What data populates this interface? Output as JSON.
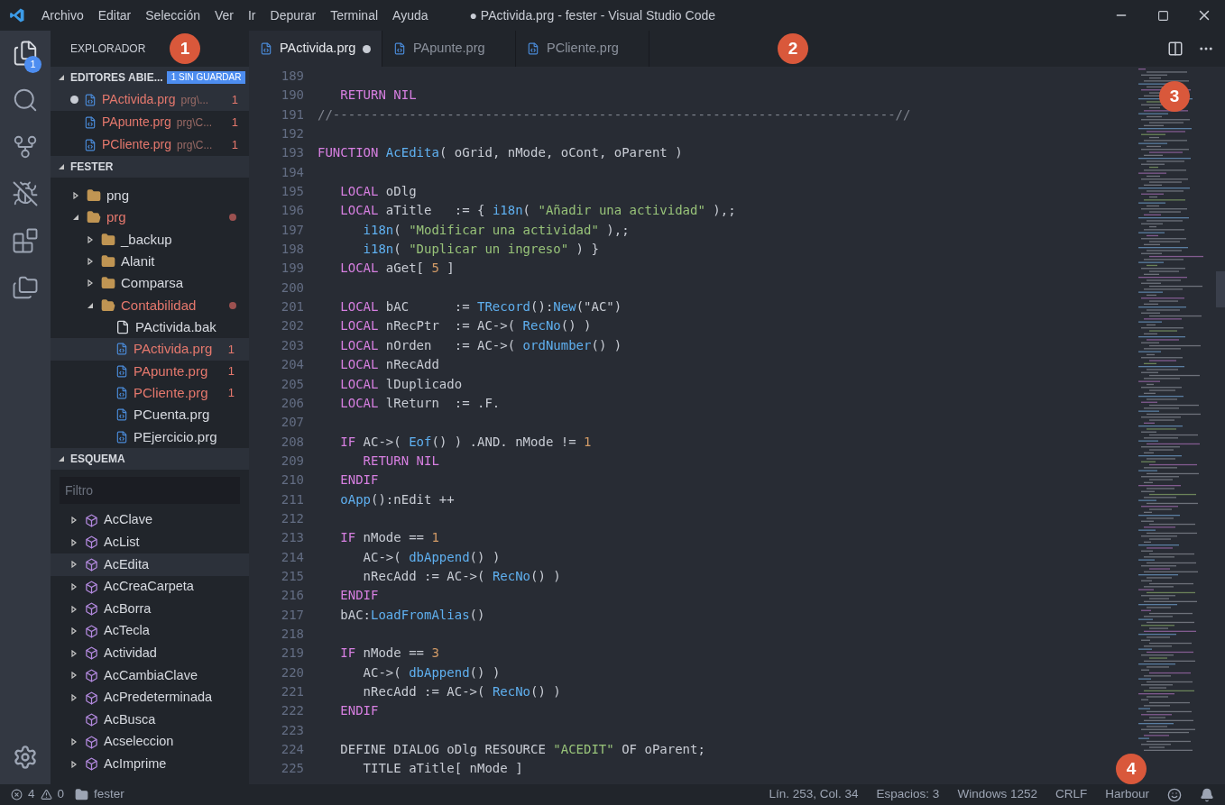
{
  "menu": [
    "Archivo",
    "Editar",
    "Selección",
    "Ver",
    "Ir",
    "Depurar",
    "Terminal",
    "Ayuda"
  ],
  "window": {
    "title": "● PActivida.prg - fester - Visual Studio Code"
  },
  "activity_bar": {
    "explorer_badge": "1"
  },
  "sidebar": {
    "title": "EXPLORADOR",
    "open_editors": {
      "title": "EDITORES ABIE...",
      "badge": "1 SIN GUARDAR",
      "expanded": true,
      "items": [
        {
          "name": "PActivida.prg",
          "path": "prg\\...",
          "problems": "1",
          "dirty": true,
          "selected": true
        },
        {
          "name": "PApunte.prg",
          "path": "prg\\C...",
          "problems": "1",
          "dirty": false,
          "selected": false
        },
        {
          "name": "PCliente.prg",
          "path": "prg\\C...",
          "problems": "1",
          "dirty": false,
          "selected": false
        }
      ]
    },
    "folder": {
      "title": "FESTER",
      "expanded": true,
      "items": [
        {
          "kind": "folder",
          "name": "png",
          "expanded": false,
          "error": false,
          "selected": false
        },
        {
          "kind": "folder",
          "name": "prg",
          "expanded": true,
          "error": true,
          "selected": false,
          "children": [
            {
              "kind": "folder",
              "name": "_backup",
              "expanded": false,
              "error": false,
              "selected": false
            },
            {
              "kind": "folder",
              "name": "Alanit",
              "expanded": false,
              "error": false,
              "selected": false
            },
            {
              "kind": "folder",
              "name": "Comparsa",
              "expanded": false,
              "error": false,
              "selected": false
            },
            {
              "kind": "folder",
              "name": "Contabilidad",
              "expanded": true,
              "error": true,
              "selected": false,
              "children": [
                {
                  "kind": "file",
                  "name": "PActivida.bak",
                  "error": false,
                  "selected": false
                },
                {
                  "kind": "code",
                  "name": "PActivida.prg",
                  "error": true,
                  "problems": "1",
                  "selected": true
                },
                {
                  "kind": "code",
                  "name": "PApunte.prg",
                  "error": true,
                  "problems": "1",
                  "selected": false
                },
                {
                  "kind": "code",
                  "name": "PCliente.prg",
                  "error": true,
                  "problems": "1",
                  "selected": false
                },
                {
                  "kind": "code",
                  "name": "PCuenta.prg",
                  "error": false,
                  "selected": false
                },
                {
                  "kind": "code",
                  "name": "PEjercicio.prg",
                  "error": false,
                  "selected": false
                }
              ]
            }
          ]
        }
      ]
    },
    "outline": {
      "title": "ESQUEMA",
      "expanded": true,
      "filter_placeholder": "Filtro",
      "items": [
        {
          "name": "AcClave",
          "expandable": true,
          "selected": false
        },
        {
          "name": "AcList",
          "expandable": true,
          "selected": false
        },
        {
          "name": "AcEdita",
          "expandable": true,
          "selected": true
        },
        {
          "name": "AcCreaCarpeta",
          "expandable": true,
          "selected": false
        },
        {
          "name": "AcBorra",
          "expandable": true,
          "selected": false
        },
        {
          "name": "AcTecla",
          "expandable": true,
          "selected": false
        },
        {
          "name": "Actividad",
          "expandable": true,
          "selected": false
        },
        {
          "name": "AcCambiaClave",
          "expandable": true,
          "selected": false
        },
        {
          "name": "AcPredeterminada",
          "expandable": true,
          "selected": false
        },
        {
          "name": "AcBusca",
          "expandable": false,
          "selected": false
        },
        {
          "name": "Acseleccion",
          "expandable": true,
          "selected": false
        },
        {
          "name": "AcImprime",
          "expandable": true,
          "selected": false
        }
      ]
    }
  },
  "tabs": [
    {
      "label": "PActivida.prg",
      "selected": true,
      "dirty": true
    },
    {
      "label": "PApunte.prg",
      "selected": false,
      "dirty": false
    },
    {
      "label": "PCliente.prg",
      "selected": false,
      "dirty": false
    }
  ],
  "code_lines": [
    {
      "n": "189"
    },
    {
      "n": "190",
      "tokens": [
        {
          "kind": "kw",
          "text": "   RETURN NIL"
        }
      ]
    },
    {
      "n": "191",
      "tokens": [
        {
          "kind": "comment",
          "text": "//--------------------------------------------------------------------------//"
        }
      ]
    },
    {
      "n": "192"
    },
    {
      "n": "193",
      "tokens": [
        {
          "kind": "kw",
          "text": "FUNCTION "
        },
        {
          "kind": "fn",
          "text": "AcEdita"
        },
        {
          "kind": "plain",
          "text": "( oGrid, nMode, oCont, oParent )"
        }
      ]
    },
    {
      "n": "194"
    },
    {
      "n": "195",
      "tokens": [
        {
          "kind": "kw",
          "text": "   LOCAL"
        },
        {
          "kind": "plain",
          "text": " oDlg"
        }
      ]
    },
    {
      "n": "196",
      "tokens": [
        {
          "kind": "kw",
          "text": "   LOCAL"
        },
        {
          "kind": "plain",
          "text": " aTitle   := { "
        },
        {
          "kind": "fn",
          "text": "i18n"
        },
        {
          "kind": "plain",
          "text": "( "
        },
        {
          "kind": "str",
          "text": "\"Añadir una actividad\""
        },
        {
          "kind": "plain",
          "text": " ),;"
        }
      ]
    },
    {
      "n": "197",
      "tokens": [
        {
          "kind": "fn",
          "text": "      i18n"
        },
        {
          "kind": "plain",
          "text": "( "
        },
        {
          "kind": "str",
          "text": "\"Modificar una actividad\""
        },
        {
          "kind": "plain",
          "text": " ),;"
        }
      ]
    },
    {
      "n": "198",
      "tokens": [
        {
          "kind": "fn",
          "text": "      i18n"
        },
        {
          "kind": "plain",
          "text": "( "
        },
        {
          "kind": "str",
          "text": "\"Duplicar un ingreso\""
        },
        {
          "kind": "plain",
          "text": " ) }"
        }
      ]
    },
    {
      "n": "199",
      "tokens": [
        {
          "kind": "kw",
          "text": "   LOCAL"
        },
        {
          "kind": "plain",
          "text": " aGet[ "
        },
        {
          "kind": "num",
          "text": "5"
        },
        {
          "kind": "plain",
          "text": " ]"
        }
      ]
    },
    {
      "n": "200"
    },
    {
      "n": "201",
      "tokens": [
        {
          "kind": "kw",
          "text": "   LOCAL"
        },
        {
          "kind": "plain",
          "text": " bAC      := "
        },
        {
          "kind": "fn",
          "text": "TRecord"
        },
        {
          "kind": "plain",
          "text": "():"
        },
        {
          "kind": "fn",
          "text": "New"
        },
        {
          "kind": "plain",
          "text": "(\"AC\")"
        }
      ]
    },
    {
      "n": "202",
      "tokens": [
        {
          "kind": "kw",
          "text": "   LOCAL"
        },
        {
          "kind": "plain",
          "text": " nRecPtr  := AC->( "
        },
        {
          "kind": "fn",
          "text": "RecNo"
        },
        {
          "kind": "plain",
          "text": "() )"
        }
      ]
    },
    {
      "n": "203",
      "tokens": [
        {
          "kind": "kw",
          "text": "   LOCAL"
        },
        {
          "kind": "plain",
          "text": " nOrden   := AC->( "
        },
        {
          "kind": "fn",
          "text": "ordNumber"
        },
        {
          "kind": "plain",
          "text": "() )"
        }
      ]
    },
    {
      "n": "204",
      "tokens": [
        {
          "kind": "kw",
          "text": "   LOCAL"
        },
        {
          "kind": "plain",
          "text": " nRecAdd"
        }
      ]
    },
    {
      "n": "205",
      "tokens": [
        {
          "kind": "kw",
          "text": "   LOCAL"
        },
        {
          "kind": "plain",
          "text": " lDuplicado"
        }
      ]
    },
    {
      "n": "206",
      "tokens": [
        {
          "kind": "kw",
          "text": "   LOCAL"
        },
        {
          "kind": "plain",
          "text": " lReturn  := .F."
        }
      ]
    },
    {
      "n": "207"
    },
    {
      "n": "208",
      "tokens": [
        {
          "kind": "kw",
          "text": "   IF"
        },
        {
          "kind": "plain",
          "text": " AC->( "
        },
        {
          "kind": "fn",
          "text": "Eof"
        },
        {
          "kind": "plain",
          "text": "() ) .AND. nMode != "
        },
        {
          "kind": "num",
          "text": "1"
        }
      ]
    },
    {
      "n": "209",
      "tokens": [
        {
          "kind": "kw",
          "text": "      RETURN NIL"
        }
      ]
    },
    {
      "n": "210",
      "tokens": [
        {
          "kind": "kw",
          "text": "   ENDIF"
        }
      ]
    },
    {
      "n": "211",
      "tokens": [
        {
          "kind": "fn",
          "text": "   oApp"
        },
        {
          "kind": "plain",
          "text": "():nEdit ++"
        }
      ]
    },
    {
      "n": "212"
    },
    {
      "n": "213",
      "tokens": [
        {
          "kind": "kw",
          "text": "   IF"
        },
        {
          "kind": "plain",
          "text": " nMode == "
        },
        {
          "kind": "num",
          "text": "1"
        }
      ]
    },
    {
      "n": "214",
      "tokens": [
        {
          "kind": "plain",
          "text": "      AC->( "
        },
        {
          "kind": "fn",
          "text": "dbAppend"
        },
        {
          "kind": "plain",
          "text": "() )"
        }
      ]
    },
    {
      "n": "215",
      "tokens": [
        {
          "kind": "plain",
          "text": "      nRecAdd := AC->( "
        },
        {
          "kind": "fn",
          "text": "RecNo"
        },
        {
          "kind": "plain",
          "text": "() )"
        }
      ]
    },
    {
      "n": "216",
      "tokens": [
        {
          "kind": "kw",
          "text": "   ENDIF"
        }
      ]
    },
    {
      "n": "217",
      "tokens": [
        {
          "kind": "plain",
          "text": "   bAC:"
        },
        {
          "kind": "fn",
          "text": "LoadFromAlias"
        },
        {
          "kind": "plain",
          "text": "()"
        }
      ]
    },
    {
      "n": "218"
    },
    {
      "n": "219",
      "tokens": [
        {
          "kind": "kw",
          "text": "   IF"
        },
        {
          "kind": "plain",
          "text": " nMode == "
        },
        {
          "kind": "num",
          "text": "3"
        }
      ]
    },
    {
      "n": "220",
      "tokens": [
        {
          "kind": "plain",
          "text": "      AC->( "
        },
        {
          "kind": "fn",
          "text": "dbAppend"
        },
        {
          "kind": "plain",
          "text": "() )"
        }
      ]
    },
    {
      "n": "221",
      "tokens": [
        {
          "kind": "plain",
          "text": "      nRecAdd := AC->( "
        },
        {
          "kind": "fn",
          "text": "RecNo"
        },
        {
          "kind": "plain",
          "text": "() )"
        }
      ]
    },
    {
      "n": "222",
      "tokens": [
        {
          "kind": "kw",
          "text": "   ENDIF"
        }
      ]
    },
    {
      "n": "223"
    },
    {
      "n": "224",
      "tokens": [
        {
          "kind": "plain",
          "text": "   DEFINE DIALOG oDlg RESOURCE "
        },
        {
          "kind": "str",
          "text": "\"ACEDIT\""
        },
        {
          "kind": "plain",
          "text": " OF oParent;"
        }
      ]
    },
    {
      "n": "225",
      "tokens": [
        {
          "kind": "plain",
          "text": "      TITLE aTitle[ nMode ]"
        }
      ]
    }
  ],
  "status_bar": {
    "errors": "4",
    "warnings": "0",
    "folder": "fester",
    "position": "Lín. 253, Col. 34",
    "indent": "Espacios: 3",
    "encoding": "Windows 1252",
    "eol": "CRLF",
    "language": "Harbour"
  },
  "callouts": [
    "1",
    "2",
    "3",
    "4"
  ]
}
